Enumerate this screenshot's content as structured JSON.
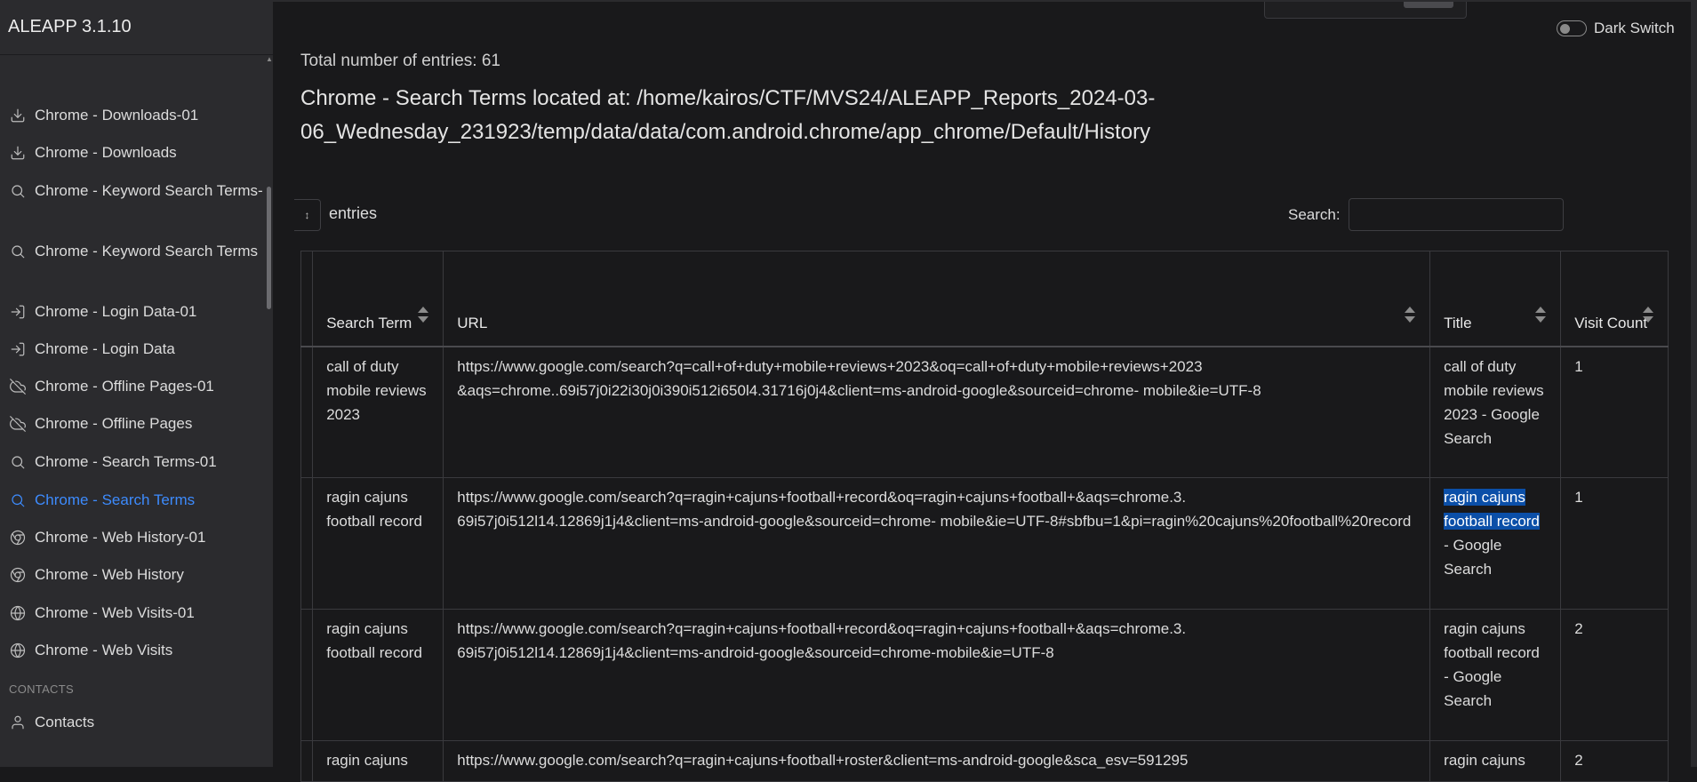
{
  "app": {
    "title": "ALEAPP 3.1.10"
  },
  "sidebar": {
    "items": [
      {
        "label": "Chrome - Downloads-01",
        "icon": "download-icon"
      },
      {
        "label": "Chrome - Downloads",
        "icon": "download-icon"
      },
      {
        "label": "Chrome - Keyword Search Terms-",
        "icon": "search-icon"
      },
      {
        "label": "Chrome - Keyword Search Terms",
        "icon": "search-icon"
      },
      {
        "label": "Chrome - Login Data-01",
        "icon": "log-in-icon"
      },
      {
        "label": "Chrome - Login Data",
        "icon": "log-in-icon"
      },
      {
        "label": "Chrome - Offline Pages-01",
        "icon": "cloud-off-icon"
      },
      {
        "label": "Chrome - Offline Pages",
        "icon": "cloud-off-icon"
      },
      {
        "label": "Chrome - Search Terms-01",
        "icon": "search-icon"
      },
      {
        "label": "Chrome - Search Terms",
        "icon": "search-icon",
        "active": true
      },
      {
        "label": "Chrome - Web History-01",
        "icon": "chrome-icon"
      },
      {
        "label": "Chrome - Web History",
        "icon": "chrome-icon"
      },
      {
        "label": "Chrome - Web Visits-01",
        "icon": "globe-icon"
      },
      {
        "label": "Chrome - Web Visits",
        "icon": "globe-icon"
      }
    ],
    "section_contacts": "CONTACTS",
    "contacts_item": {
      "label": "Contacts",
      "icon": "user-icon"
    }
  },
  "header": {
    "dark_switch_label": "Dark Switch"
  },
  "report": {
    "total": "Total number of entries: 61",
    "location": "Chrome - Search Terms located at: /home/kairos/CTF/MVS24/ALEAPP_Reports_2024-03-06_Wednesday_231923/temp/data/data/com.android.chrome/app_chrome/Default/History"
  },
  "controls": {
    "entries_select_value": "↕",
    "entries_label": "entries",
    "search_label": "Search:",
    "search_value": ""
  },
  "table": {
    "columns": [
      "Search Term",
      "URL",
      "Title",
      "Visit Count"
    ],
    "rows": [
      {
        "term": "call of duty mobile reviews 2023",
        "url": "https://www.google.com/search?q=call+of+duty+mobile+reviews+2023&oq=call+of+duty+mobile+reviews+2023 &aqs=chrome..69i57j0i22i30j0i390i512i650l4.31716j0j4&client=ms-android-google&sourceid=chrome- mobile&ie=UTF-8",
        "title": "call of duty mobile reviews 2023 - Google Search",
        "visit_count": "1"
      },
      {
        "term": "ragin cajuns football record",
        "url": "https://www.google.com/search?q=ragin+cajuns+football+record&oq=ragin+cajuns+football+&aqs=chrome.3. 69i57j0i512l14.12869j1j4&client=ms-android-google&sourceid=chrome- mobile&ie=UTF-8#sbfbu=1&pi=ragin%20cajuns%20football%20record",
        "title_highlight": "ragin cajuns football record",
        "title_rest": " - Google Search",
        "visit_count": "1"
      },
      {
        "term": "ragin cajuns football record",
        "url": "https://www.google.com/search?q=ragin+cajuns+football+record&oq=ragin+cajuns+football+&aqs=chrome.3. 69i57j0i512l14.12869j1j4&client=ms-android-google&sourceid=chrome-mobile&ie=UTF-8",
        "title": "ragin cajuns football record - Google Search",
        "visit_count": "2"
      },
      {
        "term": "ragin cajuns",
        "url": "https://www.google.com/search?q=ragin+cajuns+football+roster&client=ms-android-google&sca_esv=591295",
        "title": "ragin cajuns",
        "visit_count": "2"
      }
    ]
  },
  "colors": {
    "accent": "#3d8bfd",
    "highlight": "#0b4fa8",
    "sidebar_bg": "#2b2b2e",
    "page_bg": "#19191b"
  }
}
